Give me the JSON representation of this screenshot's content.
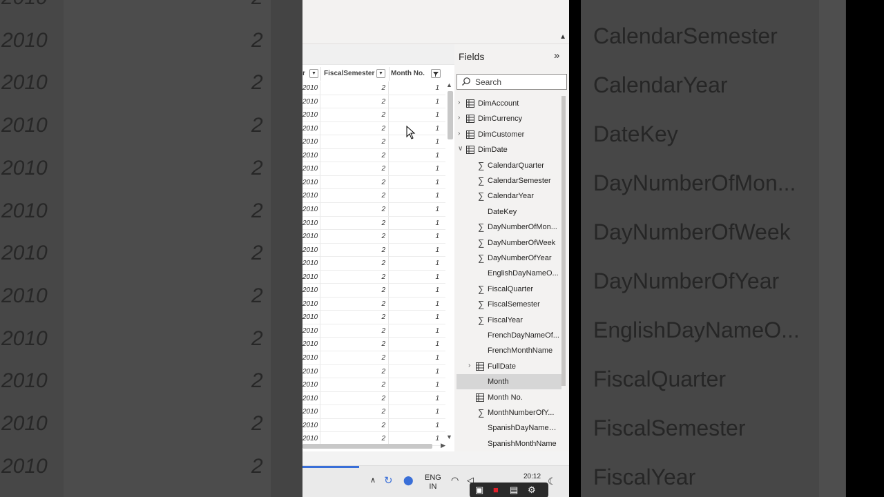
{
  "background_left": {
    "rows": [
      {
        "year": "2010",
        "val": "2"
      },
      {
        "year": "2010",
        "val": "2"
      },
      {
        "year": "2010",
        "val": "2"
      },
      {
        "year": "2010",
        "val": "2"
      },
      {
        "year": "2010",
        "val": "2"
      },
      {
        "year": "2010",
        "val": "2"
      },
      {
        "year": "2010",
        "val": "2"
      },
      {
        "year": "2010",
        "val": "2"
      },
      {
        "year": "2010",
        "val": "2"
      },
      {
        "year": "2010",
        "val": "2"
      },
      {
        "year": "2010",
        "val": "2"
      },
      {
        "year": "2010",
        "val": "2"
      }
    ]
  },
  "background_right": {
    "fields": [
      "CalendarSemester",
      "CalendarYear",
      "DateKey",
      "DayNumberOfMon...",
      "DayNumberOfWeek",
      "DayNumberOfYear",
      "EnglishDayNameO...",
      "FiscalQuarter",
      "FiscalSemester",
      "FiscalYear"
    ]
  },
  "grid": {
    "columns": [
      {
        "label": "r"
      },
      {
        "label": "FiscalSemester"
      },
      {
        "label": "Month No."
      }
    ],
    "rows": [
      [
        "2010",
        "2",
        "1"
      ],
      [
        "2010",
        "2",
        "1"
      ],
      [
        "2010",
        "2",
        "1"
      ],
      [
        "2010",
        "2",
        "1"
      ],
      [
        "2010",
        "2",
        "1"
      ],
      [
        "2010",
        "2",
        "1"
      ],
      [
        "2010",
        "2",
        "1"
      ],
      [
        "2010",
        "2",
        "1"
      ],
      [
        "2010",
        "2",
        "1"
      ],
      [
        "2010",
        "2",
        "1"
      ],
      [
        "2010",
        "2",
        "1"
      ],
      [
        "2010",
        "2",
        "1"
      ],
      [
        "2010",
        "2",
        "1"
      ],
      [
        "2010",
        "2",
        "1"
      ],
      [
        "2010",
        "2",
        "1"
      ],
      [
        "2010",
        "2",
        "1"
      ],
      [
        "2010",
        "2",
        "1"
      ],
      [
        "2010",
        "2",
        "1"
      ],
      [
        "2010",
        "2",
        "1"
      ],
      [
        "2010",
        "2",
        "1"
      ],
      [
        "2010",
        "2",
        "1"
      ],
      [
        "2010",
        "2",
        "1"
      ],
      [
        "2010",
        "2",
        "1"
      ],
      [
        "2010",
        "2",
        "1"
      ],
      [
        "2010",
        "2",
        "1"
      ],
      [
        "2010",
        "2",
        "1"
      ],
      [
        "2010",
        "2",
        "1"
      ]
    ]
  },
  "fields_pane": {
    "title": "Fields",
    "search_placeholder": "Search",
    "tables": [
      {
        "name": "DimAccount",
        "expanded": false
      },
      {
        "name": "DimCurrency",
        "expanded": false
      },
      {
        "name": "DimCustomer",
        "expanded": false
      },
      {
        "name": "DimDate",
        "expanded": true
      }
    ],
    "dimdate_fields": [
      {
        "name": "CalendarQuarter",
        "icon": "sigma-icon"
      },
      {
        "name": "CalendarSemester",
        "icon": "sigma-icon"
      },
      {
        "name": "CalendarYear",
        "icon": "sigma-icon"
      },
      {
        "name": "DateKey",
        "icon": "none"
      },
      {
        "name": "DayNumberOfMon...",
        "icon": "sigma-icon"
      },
      {
        "name": "DayNumberOfWeek",
        "icon": "sigma-icon"
      },
      {
        "name": "DayNumberOfYear",
        "icon": "sigma-icon"
      },
      {
        "name": "EnglishDayNameO...",
        "icon": "none"
      },
      {
        "name": "FiscalQuarter",
        "icon": "sigma-icon"
      },
      {
        "name": "FiscalSemester",
        "icon": "sigma-icon"
      },
      {
        "name": "FiscalYear",
        "icon": "sigma-icon"
      },
      {
        "name": "FrenchDayNameOf...",
        "icon": "none"
      },
      {
        "name": "FrenchMonthName",
        "icon": "none"
      },
      {
        "name": "FullDate",
        "icon": "calendar-icon"
      },
      {
        "name": "Month",
        "icon": "none",
        "selected": true
      },
      {
        "name": "Month No.",
        "icon": "table-sort-icon"
      },
      {
        "name": "MonthNumberOfY...",
        "icon": "sigma-icon"
      },
      {
        "name": "SpanishDayNameO...",
        "icon": "none"
      },
      {
        "name": "SpanishMonthName",
        "icon": "none"
      }
    ]
  },
  "taskbar": {
    "lang_line1": "ENG",
    "lang_line2": "IN",
    "time": "20:12"
  }
}
